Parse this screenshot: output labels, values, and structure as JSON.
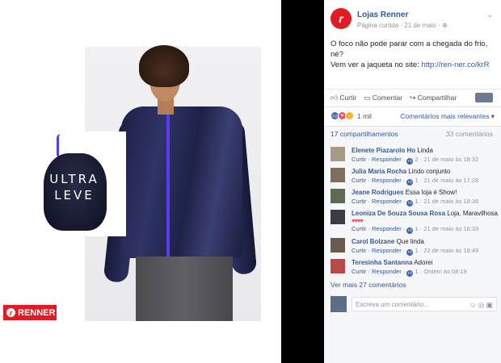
{
  "photo": {
    "pouch_line1": "ULTRA",
    "pouch_line2": "LEVE",
    "brand_logo": "RENNER",
    "jacket_zip_color": "#5a3cf0"
  },
  "post": {
    "page_name": "Lojas Renner",
    "page_type": "Página curtida",
    "date": "21 de maio",
    "text_line1": "O foco não pode parar com a chegada do frio, né?",
    "text_line2_prefix": "Vem ver a jaqueta no site: ",
    "link": "http://ren-ner.co/krR"
  },
  "actions": {
    "like": "Curtir",
    "comment": "Comentar",
    "share": "Compartilhar"
  },
  "stats": {
    "reactions_count": "1 mil",
    "relevant_label": "Comentários mais relevantes",
    "shares": "17 compartilhamentos",
    "comments_count": "33 comentários"
  },
  "comments": [
    {
      "author": "Elenete Piazarolo Ho",
      "text": "Linda",
      "reply": "Curtir · Responder ·",
      "likes": "2",
      "time": "21 de maio às 18:32"
    },
    {
      "author": "Julia Maria Rocha",
      "text": "Lindo conjunto",
      "reply": "Curtir · Responder ·",
      "likes": "1",
      "time": "21 de maio às 17:28"
    },
    {
      "author": "Jeane Rodrigues",
      "text": "Essa loja é Show!",
      "reply": "Curtir · Responder ·",
      "likes": "1",
      "time": "21 de maio às 18:36"
    },
    {
      "author": "Leoniza De Souza Sousa Rosa",
      "text": "Loja. Maravilhosa.",
      "hearts": "♥♥♥♥",
      "reply": "Curtir · Responder ·",
      "likes": "1",
      "time": "21 de maio às 16:33"
    },
    {
      "author": "Carol Bolzane",
      "text": "Que linda",
      "reply": "Curtir · Responder ·",
      "likes": "1",
      "time": "22 de maio às 18:49"
    },
    {
      "author": "Teresinha Santanna",
      "text": "Adorei",
      "reply": "Curtir · Responder ·",
      "likes": "1",
      "time": "Ontem às 08:19"
    }
  ],
  "more_comments": "Ver mais 27 comentários",
  "write_placeholder": "Escreva um comentário...",
  "colors": {
    "brand_red": "#e11b22",
    "link_blue": "#365899"
  }
}
